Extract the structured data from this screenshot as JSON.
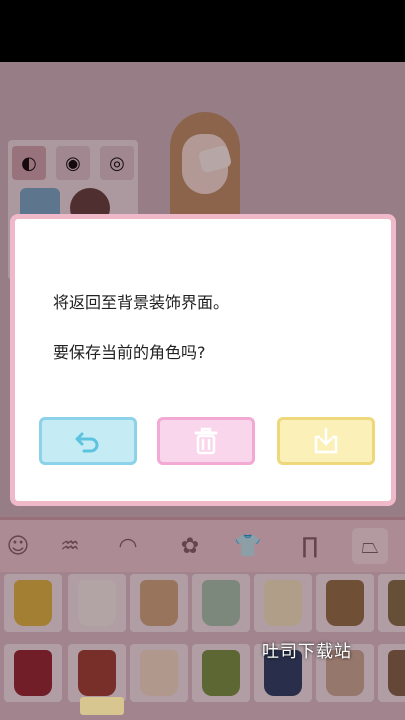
{
  "dialog": {
    "line1": "将返回至背景装饰界面。",
    "line2": "要保存当前的角色吗?",
    "buttons": {
      "back_icon": "undo-arrow-icon",
      "delete_icon": "trash-icon",
      "save_icon": "save-download-icon"
    }
  },
  "categories": [
    "face-icon",
    "hair-long-icon",
    "hair-short-icon",
    "bow-icon",
    "shirt-icon",
    "pants-icon",
    "skirt-icon"
  ],
  "watermark": "吐司下载站",
  "colors": {
    "dialog_border": "#f0b9ca",
    "back_button": "#c5ecf5",
    "delete_button": "#fad6ec",
    "save_button": "#fbf1b8"
  }
}
